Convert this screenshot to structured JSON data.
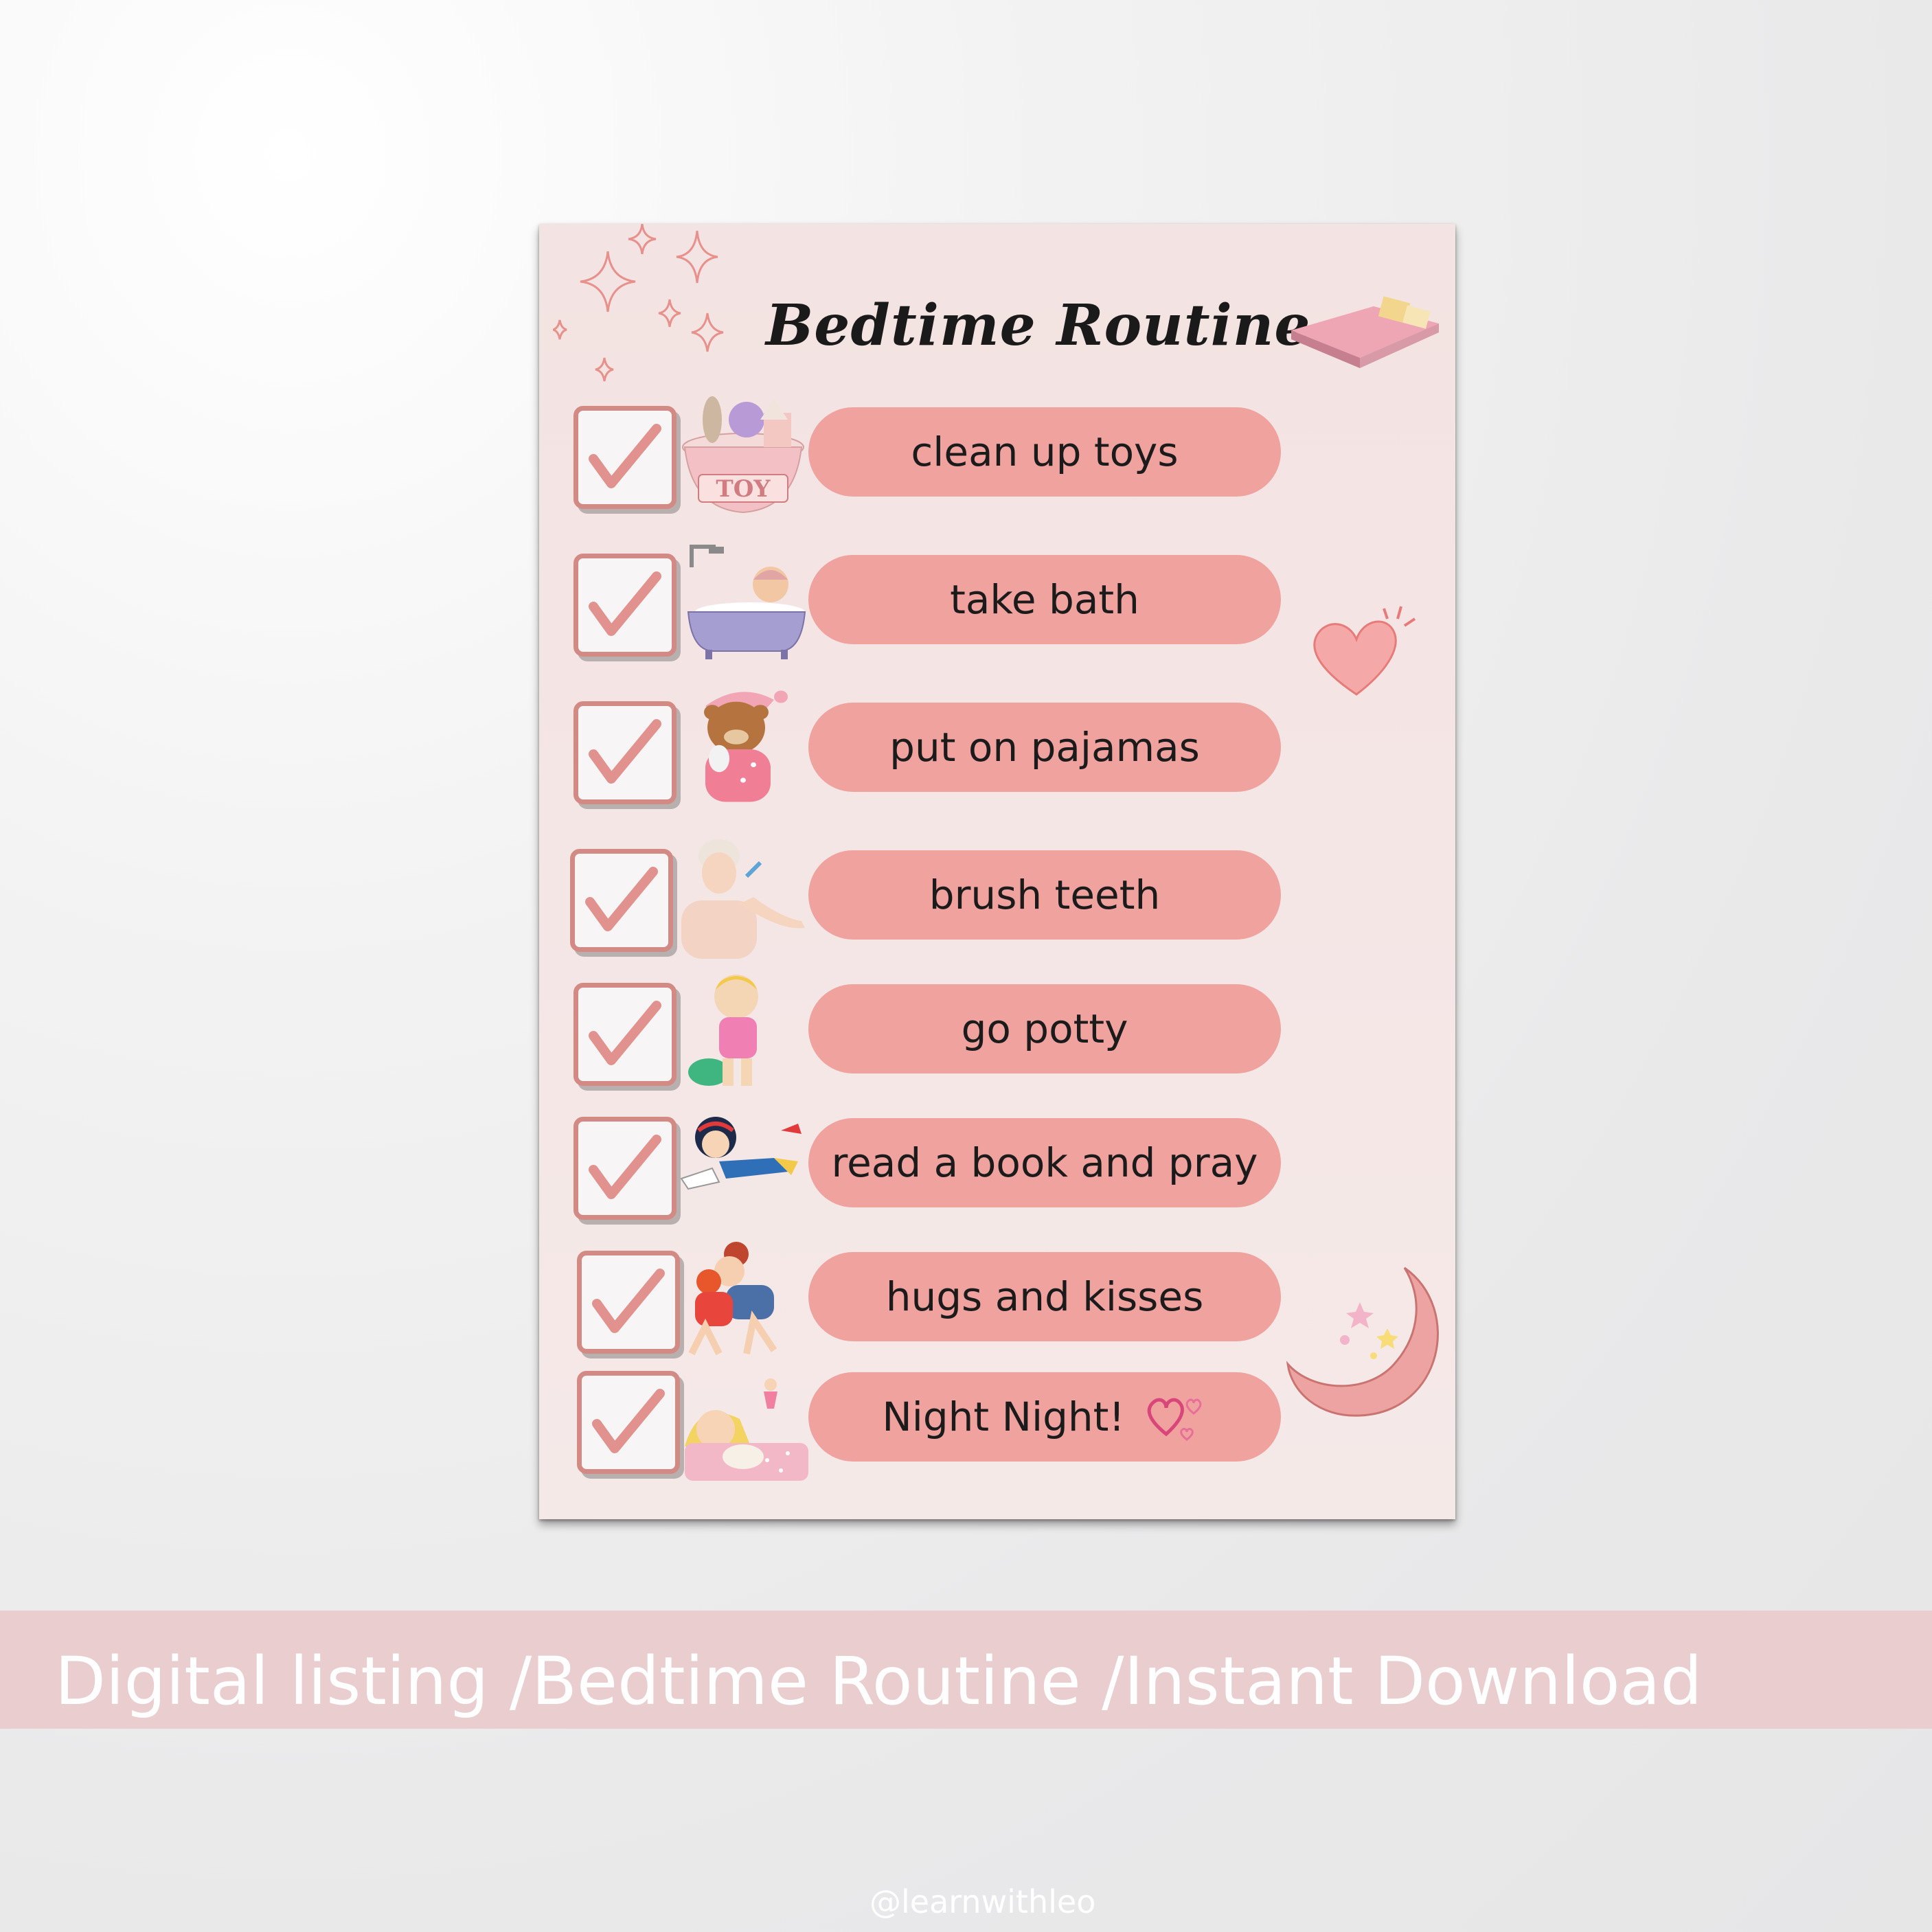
{
  "poster": {
    "title": "Bedtime Routine",
    "items": [
      {
        "label": "clean up toys",
        "icon": "toy-basket-icon",
        "badge": "TOY"
      },
      {
        "label": "take bath",
        "icon": "bathtub-icon"
      },
      {
        "label": "put on pajamas",
        "icon": "teddy-bear-pajamas-icon"
      },
      {
        "label": "brush teeth",
        "icon": "brushing-teeth-icon"
      },
      {
        "label": "go potty",
        "icon": "potty-icon"
      },
      {
        "label": "read a book and pray",
        "icon": "reading-girl-icon"
      },
      {
        "label": "hugs and kisses",
        "icon": "hugging-icon"
      },
      {
        "label": "Night Night!",
        "icon": "sleeping-girl-icon"
      }
    ],
    "checked": true
  },
  "banner": {
    "text": "Digital listing /Bedtime Routine /Instant Download"
  },
  "watermark": {
    "text": "@learnwithleo"
  },
  "colors": {
    "background": "#e9e9ea",
    "poster": "#f3e3e2",
    "pill": "#efa29e",
    "checkbox_border": "#d38a85",
    "banner": "#e9cdcf"
  }
}
